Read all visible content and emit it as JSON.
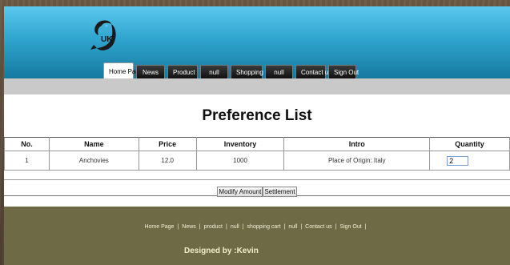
{
  "header": {
    "logo_text": "UK"
  },
  "nav": {
    "items": [
      "Home Page",
      "News",
      "Product",
      "null",
      "Shopping cart",
      "null",
      "Contact us",
      "Sign Out"
    ],
    "active": "Home Page"
  },
  "page_title": "Preference List",
  "table": {
    "columns": [
      "No.",
      "Name",
      "Price",
      "Inventory",
      "Intro",
      "Quantity"
    ],
    "rows": [
      {
        "no": "1",
        "name": "Anchovies",
        "price": "12.0",
        "inventory": "1000",
        "intro": "Place of Origin: Italy",
        "quantity": "2"
      }
    ]
  },
  "actions": {
    "modify_label": "Modify Amount",
    "settlement_label": "Settlement"
  },
  "footer": {
    "links": [
      "Home Page",
      "News",
      "product",
      "null",
      "shopping cart",
      "null",
      "Contact us",
      "Sign Out"
    ],
    "credit": "Designed by :Kevin"
  },
  "colors": {
    "header_top": "#5cc8ef",
    "header_bottom": "#16799f",
    "footer_bg": "#6e6a45"
  }
}
